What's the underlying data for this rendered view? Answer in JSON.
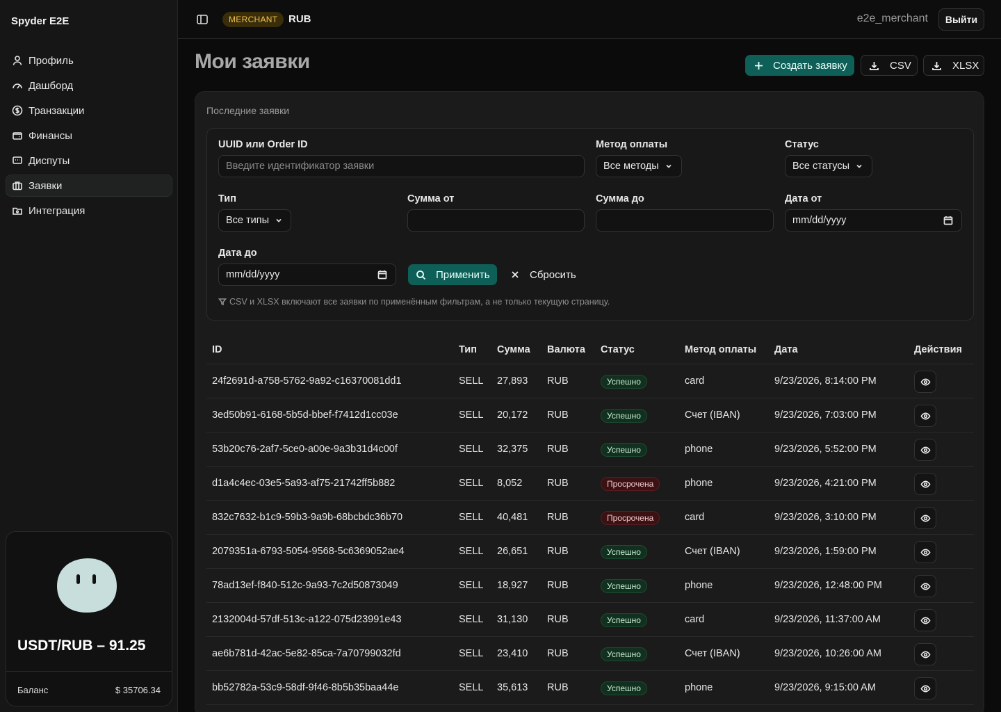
{
  "app": {
    "name": "Spyder E2E"
  },
  "sidebar": {
    "items": [
      {
        "label": "Профиль",
        "icon": "user-icon"
      },
      {
        "label": "Дашборд",
        "icon": "gauge-icon"
      },
      {
        "label": "Транзакции",
        "icon": "dollar-circle-icon"
      },
      {
        "label": "Финансы",
        "icon": "wallet-icon"
      },
      {
        "label": "Диспуты",
        "icon": "chat-icon"
      },
      {
        "label": "Заявки",
        "icon": "briefcase-icon",
        "active": true
      },
      {
        "label": "Интеграция",
        "icon": "folder-icon"
      }
    ],
    "rate": "USDT/RUB – 91.25",
    "balance_label": "Баланс",
    "balance_value": "$ 35706.34"
  },
  "topbar": {
    "role_badge": "MERCHANT",
    "currency": "RUB",
    "username": "e2e_merchant",
    "logout_label": "Выйти"
  },
  "page": {
    "title": "Мои заявки",
    "create_label": "Создать заявку",
    "csv_label": "CSV",
    "xlsx_label": "XLSX",
    "panel_title": "Последние заявки"
  },
  "filters": {
    "uuid_label": "UUID или Order ID",
    "uuid_placeholder": "Введите идентификатор заявки",
    "method_label": "Метод оплаты",
    "method_value": "Все методы",
    "status_label": "Статус",
    "status_value": "Все статусы",
    "type_label": "Тип",
    "type_value": "Все типы",
    "sum_from_label": "Сумма от",
    "sum_to_label": "Сумма до",
    "date_from_label": "Дата от",
    "date_from_value": "mm/dd/yyyy",
    "date_to_label": "Дата до",
    "date_to_value": "mm/dd/yyyy",
    "apply_label": "Применить",
    "reset_label": "Сбросить",
    "hint": "CSV и XLSX включают все заявки по применённым фильтрам, а не только текущую страницу."
  },
  "table": {
    "headers": {
      "id": "ID",
      "type": "Тип",
      "sum": "Сумма",
      "currency": "Валюта",
      "status": "Статус",
      "method": "Метод оплаты",
      "date": "Дата",
      "actions": "Действия"
    },
    "rows": [
      {
        "id": "24f2691d-a758-5762-9a92-c16370081dd1",
        "type": "SELL",
        "sum": "27,893",
        "currency": "RUB",
        "status": "Успешно",
        "status_kind": "ok",
        "method": "card",
        "date": "9/23/2026, 8:14:00 PM"
      },
      {
        "id": "3ed50b91-6168-5b5d-bbef-f7412d1cc03e",
        "type": "SELL",
        "sum": "20,172",
        "currency": "RUB",
        "status": "Успешно",
        "status_kind": "ok",
        "method": "Счет (IBAN)",
        "date": "9/23/2026, 7:03:00 PM"
      },
      {
        "id": "53b20c76-2af7-5ce0-a00e-9a3b31d4c00f",
        "type": "SELL",
        "sum": "32,375",
        "currency": "RUB",
        "status": "Успешно",
        "status_kind": "ok",
        "method": "phone",
        "date": "9/23/2026, 5:52:00 PM"
      },
      {
        "id": "d1a4c4ec-03e5-5a93-af75-21742ff5b882",
        "type": "SELL",
        "sum": "8,052",
        "currency": "RUB",
        "status": "Просрочена",
        "status_kind": "bad",
        "method": "phone",
        "date": "9/23/2026, 4:21:00 PM"
      },
      {
        "id": "832c7632-b1c9-59b3-9a9b-68bcbdc36b70",
        "type": "SELL",
        "sum": "40,481",
        "currency": "RUB",
        "status": "Просрочена",
        "status_kind": "bad",
        "method": "card",
        "date": "9/23/2026, 3:10:00 PM"
      },
      {
        "id": "2079351a-6793-5054-9568-5c6369052ae4",
        "type": "SELL",
        "sum": "26,651",
        "currency": "RUB",
        "status": "Успешно",
        "status_kind": "ok",
        "method": "Счет (IBAN)",
        "date": "9/23/2026, 1:59:00 PM"
      },
      {
        "id": "78ad13ef-f840-512c-9a93-7c2d50873049",
        "type": "SELL",
        "sum": "18,927",
        "currency": "RUB",
        "status": "Успешно",
        "status_kind": "ok",
        "method": "phone",
        "date": "9/23/2026, 12:48:00 PM"
      },
      {
        "id": "2132004d-57df-513c-a122-075d23991e43",
        "type": "SELL",
        "sum": "31,130",
        "currency": "RUB",
        "status": "Успешно",
        "status_kind": "ok",
        "method": "card",
        "date": "9/23/2026, 11:37:00 AM"
      },
      {
        "id": "ae6b781d-42ac-5e82-85ca-7a70799032fd",
        "type": "SELL",
        "sum": "23,410",
        "currency": "RUB",
        "status": "Успешно",
        "status_kind": "ok",
        "method": "Счет (IBAN)",
        "date": "9/23/2026, 10:26:00 AM"
      },
      {
        "id": "bb52782a-53c9-58df-9f46-8b5b35baa44e",
        "type": "SELL",
        "sum": "35,613",
        "currency": "RUB",
        "status": "Успешно",
        "status_kind": "ok",
        "method": "phone",
        "date": "9/23/2026, 9:15:00 AM"
      }
    ]
  },
  "colors": {
    "accent": "#0e5f58",
    "badge": "#f2c14e",
    "success": "#12301f",
    "danger": "#3a1214"
  }
}
